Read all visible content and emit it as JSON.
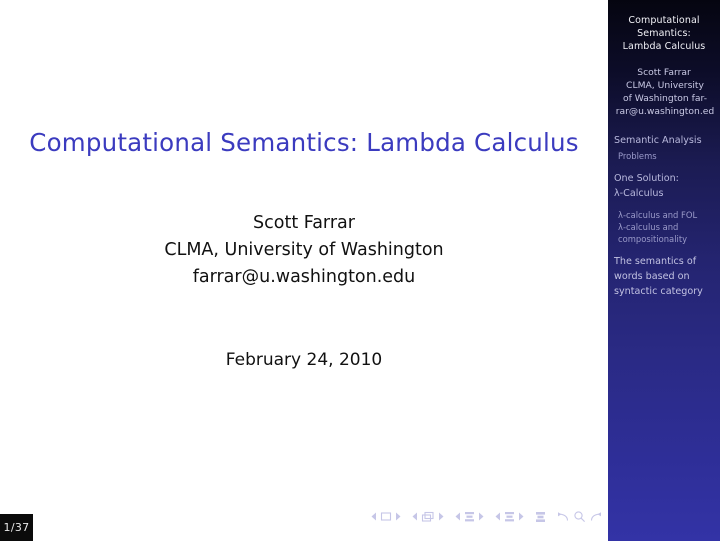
{
  "slide": {
    "title": "Computational Semantics:  Lambda Calculus",
    "author_lines": [
      "Scott Farrar",
      "CLMA, University of Washington",
      "farrar@u.washington.edu"
    ],
    "date": "February 24, 2010"
  },
  "sidebar": {
    "title_lines": [
      "Computational",
      "Semantics:",
      "Lambda Calculus"
    ],
    "author_lines": [
      "Scott Farrar",
      "CLMA, University",
      "of Washington far-",
      "rar@u.washington.ed"
    ],
    "nav": [
      {
        "label": "Semantic Analysis",
        "level": "section"
      },
      {
        "label": "Problems",
        "level": "subsection"
      },
      {
        "label": "One Solution:",
        "level": "section"
      },
      {
        "label": "λ-Calculus",
        "level": "section-cont"
      },
      {
        "label": "λ-calculus and FOL",
        "level": "subsection"
      },
      {
        "label": "λ-calculus and",
        "level": "subsection"
      },
      {
        "label": "compositionality",
        "level": "subsection-cont"
      },
      {
        "label": "The semantics of",
        "level": "section"
      },
      {
        "label": "words based on",
        "level": "section-cont"
      },
      {
        "label": "syntactic category",
        "level": "section-cont"
      }
    ]
  },
  "footer": {
    "page_indicator": "1/37",
    "nav_symbols": [
      "first-slide-icon",
      "previous-slide-icon",
      "next-slide-icon",
      "last-slide-icon",
      "back-icon",
      "find-icon",
      "forward-icon"
    ]
  },
  "colors": {
    "title_blue": "#3b3bbf",
    "sidebar_top": "#050510",
    "sidebar_bottom": "#3333a6",
    "nav_symbol": "#c3c3e6",
    "page_box_bg": "#0b0b0b"
  }
}
